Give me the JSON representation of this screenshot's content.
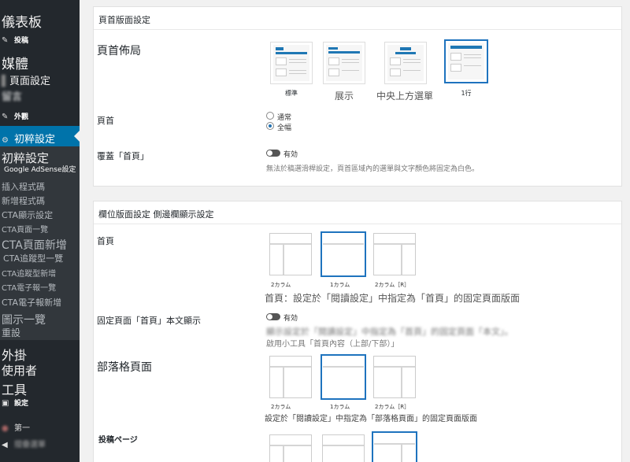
{
  "sidebar": {
    "items": [
      {
        "label": "儀表板"
      },
      {
        "label": "投稿",
        "icon": "pin-icon"
      },
      {
        "label": "媒體"
      },
      {
        "label": "頁面設定"
      },
      {
        "label": "留言"
      },
      {
        "label": "外觀",
        "icon": "brush-icon"
      },
      {
        "label": "初粹設定",
        "icon": "gear-icon"
      },
      {
        "label": "初粹設定"
      },
      {
        "label": "Google AdSense設定"
      },
      {
        "label": "插入程式碼"
      },
      {
        "label": "新增程式碼"
      },
      {
        "label": "CTA顯示設定"
      },
      {
        "label": "CTA頁面一覽"
      },
      {
        "label": "CTA頁面新增"
      },
      {
        "label": "CTA追蹤型一覽"
      },
      {
        "label": "CTA追蹤型新增"
      },
      {
        "label": "CTA電子報一覽"
      },
      {
        "label": "CTA電子報新增"
      },
      {
        "label": "圖示一覽"
      },
      {
        "label": "重設"
      },
      {
        "label": "外掛"
      },
      {
        "label": "使用者"
      },
      {
        "label": "工具"
      },
      {
        "label": "設定",
        "icon": "settings-icon"
      },
      {
        "label": "第一"
      },
      {
        "label": "摺疊選單"
      }
    ]
  },
  "header_panel": {
    "title": "頁首版面設定",
    "layout_label": "頁首佈局",
    "layouts": [
      {
        "caption": "標準"
      },
      {
        "caption": "展示"
      },
      {
        "caption": "中央上方選單"
      },
      {
        "caption": "1行"
      }
    ],
    "selected_layout": "1行",
    "header_label": "頁首",
    "radio_options": [
      "通常",
      "全幅"
    ],
    "radio_selected": "全幅",
    "overlay_label": "覆蓋「首頁」",
    "overlay_toggle": "有効",
    "overlay_desc": "無法於稿選滑桿設定，頁首區域內的選單與文字顏色將固定為白色。"
  },
  "column_panel": {
    "title": "欄位版面設定 側邊欄顯示設定",
    "home_label": "首頁",
    "home_caps": [
      "2カラム",
      "1カラム",
      "2カラム［R］"
    ],
    "home_desc": "首頁：設定於「閱讀設定」中指定為「首頁」的固定頁面版面",
    "fixed_label": "固定頁面「首頁」本文顯示",
    "fixed_toggle": "有効",
    "fixed_desc1": "顯示設定於「閱讀設定」中指定為「首頁」的固定頁面「本文」。",
    "fixed_desc2": "啟用小工具「首頁內容（上部/下部）」",
    "blog_label": "部落格頁面",
    "blog_caps": [
      "2カラム",
      "1カラム",
      "2カラム［R］"
    ],
    "blog_desc": "設定於「閱讀設定」中指定為「部落格頁面」的固定頁面版面",
    "post_label": "投稿ページ"
  },
  "colors": {
    "accent": "#0073aa",
    "selected_outline": "#1e73be",
    "sidebar_bg": "#23282d"
  }
}
